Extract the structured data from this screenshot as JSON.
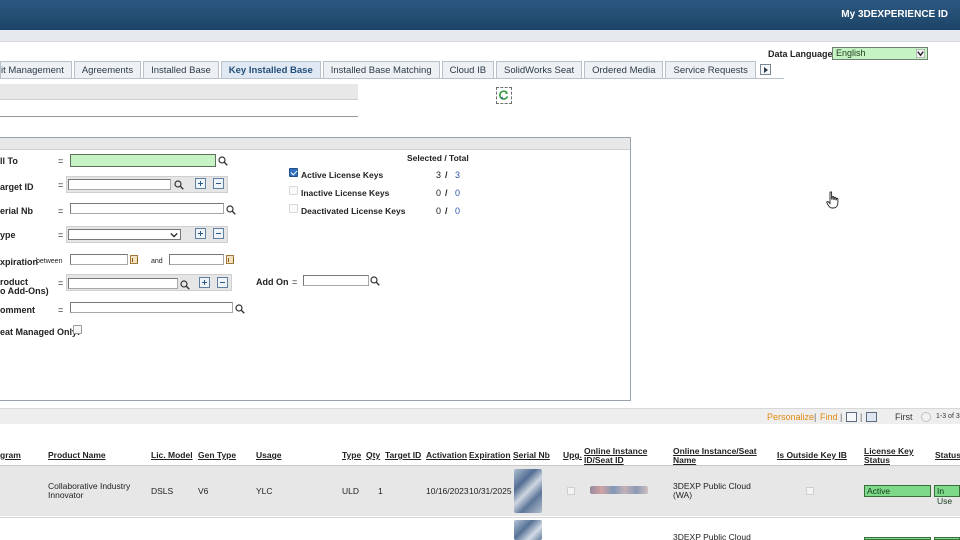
{
  "header": {
    "my_id": "My 3DEXPERIENCE ID"
  },
  "tabs": [
    {
      "label": "it Management",
      "active": false
    },
    {
      "label": "Agreements",
      "active": false
    },
    {
      "label": "Installed Base",
      "active": false
    },
    {
      "label": "Key Installed Base",
      "active": true
    },
    {
      "label": "Installed Base Matching",
      "active": false
    },
    {
      "label": "Cloud IB",
      "active": false
    },
    {
      "label": "SolidWorks Seat",
      "active": false
    },
    {
      "label": "Ordered Media",
      "active": false
    },
    {
      "label": "Service Requests",
      "active": false
    }
  ],
  "data_language": {
    "label": "Data Language:",
    "value": "English"
  },
  "search": {
    "fields": {
      "sold_to": "ll To",
      "target_id": "arget ID",
      "serial_nb": "erial Nb",
      "type": "ype",
      "expiration": "xpiration",
      "between": "between",
      "and": "and",
      "product_line1": "roduct",
      "product_line2": "o Add-Ons)",
      "comment": "omment",
      "seat_managed": "eat Managed Only:",
      "add_on": "Add On",
      "eq": "="
    },
    "status_header": "Selected / Total",
    "statuses": [
      {
        "label": "Active License Keys",
        "selected": "3",
        "sep": "/",
        "total": "3",
        "checked": true
      },
      {
        "label": "Inactive License Keys",
        "selected": "0",
        "sep": "/",
        "total": "0",
        "checked": false
      },
      {
        "label": "Deactivated License Keys",
        "selected": "0",
        "sep": "/",
        "total": "0",
        "checked": false
      }
    ]
  },
  "toolbar": {
    "personalize": "Personalize",
    "sep": "|",
    "find": "Find",
    "first": "First",
    "range": "1-3 of 3"
  },
  "table": {
    "headers": {
      "program": "gram",
      "product_name": "Product Name",
      "lic_model": "Lic. Model",
      "gen_type": "Gen Type",
      "usage": "Usage",
      "type": "Type",
      "qty": "Qty",
      "target_id": "Target ID",
      "activation": "Activation",
      "expiration": "Expiration",
      "serial_nb": "Serial Nb",
      "upg": "Upg.",
      "online_instance_l1": "Online Instance",
      "online_instance_l2": "ID/Seat ID",
      "online_seat_l1": "Online Instance/Seat",
      "online_seat_l2": "Name",
      "outside_key": "Is Outside Key IB",
      "lk_status_l1": "License Key",
      "lk_status_l2": "Status",
      "status": "Status"
    },
    "rows": [
      {
        "product_l1": "Collaborative Industry",
        "product_l2": "Innovator",
        "lic_model": "DSLS",
        "gen_type": "V6",
        "usage": "YLC",
        "type": "ULD",
        "qty": "1",
        "activation": "10/16/2023",
        "expiration": "10/31/2025",
        "seat_name_l1": "3DEXP Public Cloud",
        "seat_name_l2": "(WA)",
        "lk_status": "Active",
        "status": "In Use"
      },
      {
        "seat_name_l1": "3DEXP Public Cloud"
      }
    ]
  },
  "colors": {
    "header": "#1d4468",
    "green_field": "#c6f3c3",
    "orange_link": "#e08a12",
    "active_pill": "#7fd98a"
  }
}
